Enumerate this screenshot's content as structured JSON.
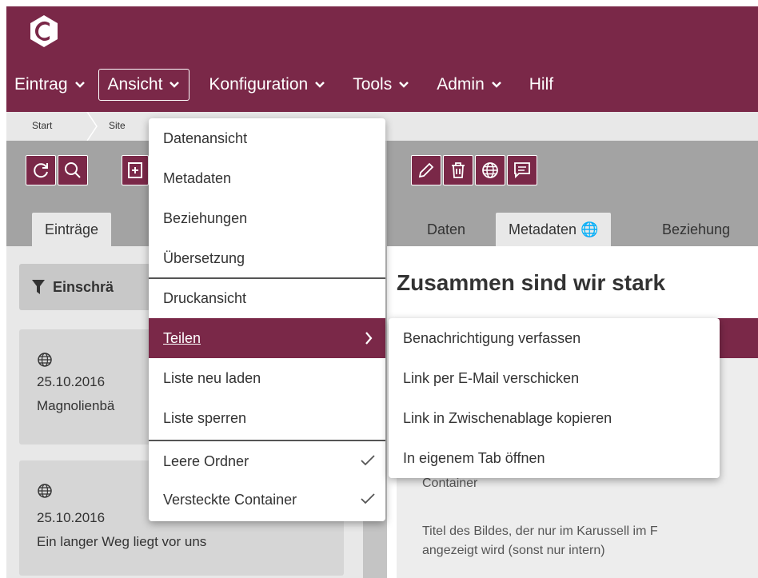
{
  "header": {
    "logo_icon": "app-logo-icon",
    "nav": [
      {
        "label": "Eintrag"
      },
      {
        "label": "Ansicht"
      },
      {
        "label": "Konfiguration"
      },
      {
        "label": "Tools"
      },
      {
        "label": "Admin"
      },
      {
        "label": "Hilf"
      }
    ]
  },
  "breadcrumb": {
    "items": [
      "Start",
      "Site"
    ]
  },
  "left_panel": {
    "toolbar_icons": [
      "refresh-icon",
      "search-icon",
      "add-icon"
    ],
    "tab": "Einträge",
    "filter_label": "Einschrä",
    "cards": [
      {
        "icon": "globe-icon",
        "date": "25.10.2016",
        "title": "Magnolienbä"
      },
      {
        "icon": "globe-icon",
        "date": "25.10.2016",
        "title": "Ein langer Weg liegt vor uns"
      }
    ]
  },
  "right_panel": {
    "toolbar_icons": [
      "edit-icon",
      "trash-icon",
      "globe-icon",
      "comment-icon"
    ],
    "tabs": [
      "Daten",
      "Metadaten 🌐",
      "Beziehung"
    ],
    "title": "Zusammen sind wir stark",
    "text_lines": [
      "Container",
      "Titel des Bildes, der nur im Karussell im F",
      "angezeigt wird (sonst nur intern)"
    ]
  },
  "dropdown": {
    "items": [
      {
        "label": "Datenansicht"
      },
      {
        "label": "Metadaten"
      },
      {
        "label": "Beziehungen"
      },
      {
        "label": "Übersetzung"
      },
      {
        "label": "Druckansicht"
      },
      {
        "label": "Teilen"
      },
      {
        "label": "Liste neu laden"
      },
      {
        "label": "Liste sperren"
      },
      {
        "label": "Leere Ordner",
        "checked": true
      },
      {
        "label": "Versteckte Container",
        "checked": true
      }
    ]
  },
  "submenu": {
    "items": [
      {
        "label": "Benachrichtigung verfassen"
      },
      {
        "label": "Link per E-Mail verschicken"
      },
      {
        "label": "Link in Zwischenablage kopieren"
      },
      {
        "label": "In eigenem Tab öffnen"
      }
    ]
  },
  "colors": {
    "brand": "#7a2848",
    "panel_gray": "#e8e8e8",
    "dark_gray": "#a3a3a3"
  }
}
